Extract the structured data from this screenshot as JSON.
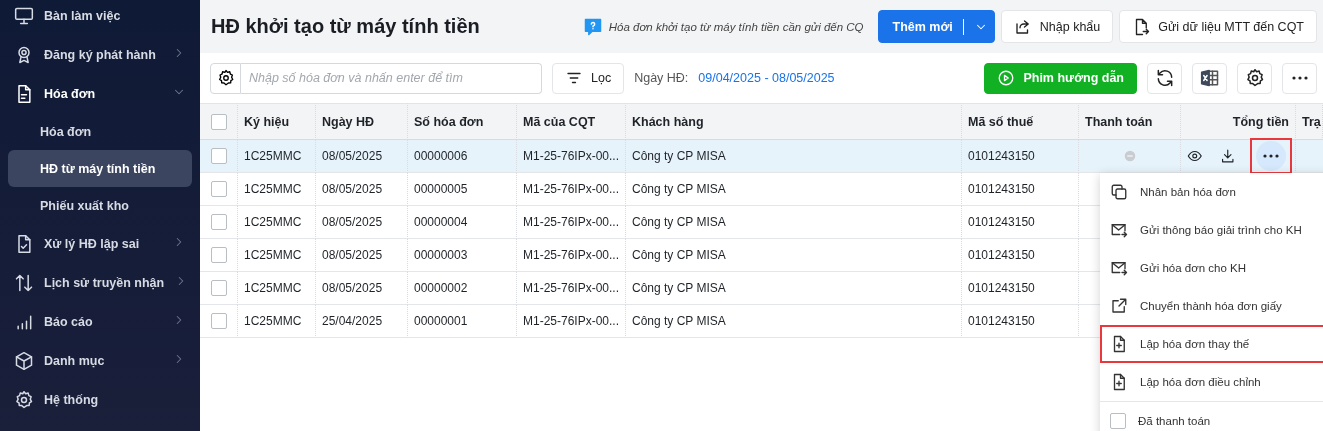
{
  "sidebar": {
    "items": [
      {
        "label": "Bàn làm việc",
        "selected": false
      },
      {
        "label": "Đăng ký phát hành",
        "selected": false,
        "expanded": false
      },
      {
        "label": "Hóa đơn",
        "selected": false,
        "expanded": true,
        "children": [
          {
            "label": "Hóa đơn",
            "selected": false
          },
          {
            "label": "HĐ từ máy tính tiền",
            "selected": true
          },
          {
            "label": "Phiếu xuất kho",
            "selected": false
          }
        ]
      },
      {
        "label": "Xử lý HĐ lập sai",
        "selected": false,
        "expanded": false
      },
      {
        "label": "Lịch sử truyền nhận",
        "selected": false,
        "expanded": false
      },
      {
        "label": "Báo cáo",
        "selected": false,
        "expanded": false
      },
      {
        "label": "Danh mục",
        "selected": false,
        "expanded": false
      },
      {
        "label": "Hệ thống",
        "selected": false
      }
    ]
  },
  "header": {
    "title": "HĐ khởi tạo từ máy tính tiền",
    "hint": "Hóa đơn khởi tạo từ máy tính tiền cần gửi đến CQ",
    "buttons": [
      "Thêm mới",
      "Nhập khẩu",
      "Gửi dữ liệu MTT đến CQT"
    ]
  },
  "toolbar": {
    "search": {
      "placeholder": "Nhập số hóa đơn và nhấn enter để tìm"
    },
    "filter": "Lọc",
    "date_label": "Ngày HĐ:",
    "date_range": "09/04/2025 - 08/05/2025",
    "guide_button": "Phim hướng dẫn"
  },
  "table": {
    "columns": [
      "Ký hiệu",
      "Ngày HĐ",
      "Số hóa đơn",
      "Mã của CQT",
      "Khách hàng",
      "Mã số thuế",
      "Thanh toán",
      "Tổng tiền",
      "Trạ"
    ],
    "header_checked": false,
    "rows": [
      {
        "selected": true,
        "checked": false,
        "cells": [
          "1C25MMC",
          "08/05/2025",
          "00000006",
          "M1-25-76IPx-00...",
          "Công ty CP MISA",
          "0101243150"
        ]
      },
      {
        "selected": false,
        "checked": false,
        "cells": [
          "1C25MMC",
          "08/05/2025",
          "00000005",
          "M1-25-76IPx-00...",
          "Công ty CP MISA",
          "0101243150"
        ]
      },
      {
        "selected": false,
        "checked": false,
        "cells": [
          "1C25MMC",
          "08/05/2025",
          "00000004",
          "M1-25-76IPx-00...",
          "Công ty CP MISA",
          "0101243150"
        ]
      },
      {
        "selected": false,
        "checked": false,
        "cells": [
          "1C25MMC",
          "08/05/2025",
          "00000003",
          "M1-25-76IPx-00...",
          "Công ty CP MISA",
          "0101243150"
        ]
      },
      {
        "selected": false,
        "checked": false,
        "cells": [
          "1C25MMC",
          "08/05/2025",
          "00000002",
          "M1-25-76IPx-00...",
          "Công ty CP MISA",
          "0101243150"
        ]
      },
      {
        "selected": false,
        "checked": false,
        "cells": [
          "1C25MMC",
          "25/04/2025",
          "00000001",
          "M1-25-76IPx-00...",
          "Công ty CP MISA",
          "0101243150"
        ]
      }
    ],
    "more_highlighted": true
  },
  "context_menu": {
    "items": [
      {
        "kind": "action",
        "label": "Nhân bản hóa đơn",
        "highlighted": false
      },
      {
        "kind": "action",
        "label": "Gửi thông báo giải trình cho KH",
        "highlighted": false
      },
      {
        "kind": "action",
        "label": "Gửi hóa đơn cho KH",
        "highlighted": false
      },
      {
        "kind": "action",
        "label": "Chuyển thành hóa đơn giấy",
        "highlighted": false
      },
      {
        "kind": "action",
        "label": "Lập hóa đơn thay thế",
        "highlighted": true
      },
      {
        "kind": "action",
        "label": "Lập hóa đơn điều chỉnh",
        "highlighted": false
      },
      {
        "kind": "checkbox",
        "label": "Đã thanh toán",
        "checked": false,
        "highlighted": false
      }
    ]
  }
}
